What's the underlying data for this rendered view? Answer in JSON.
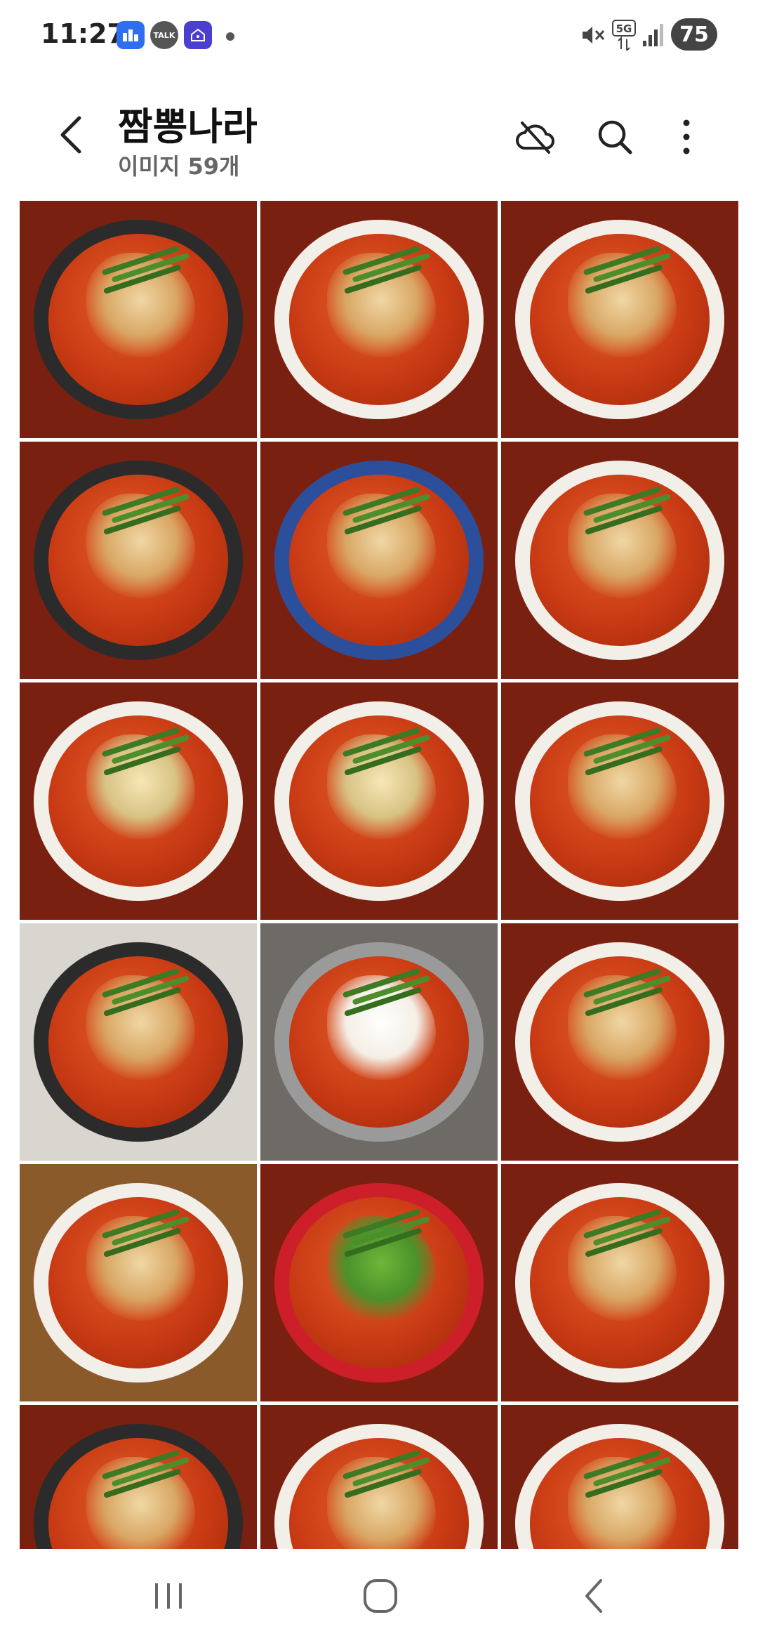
{
  "status_bar": {
    "time": "11:27",
    "notif_icons": [
      "home-app-icon",
      "talk-icon",
      "smart-home-icon"
    ],
    "talk_label": "TALK",
    "network_label": "5G",
    "battery": "75"
  },
  "header": {
    "title": "짬뽕나라",
    "subtitle": "이미지 59개"
  },
  "grid": {
    "columns": 3,
    "visible_rows": 6,
    "items": [
      {
        "style": "dark-bowl"
      },
      {
        "style": "white-bowl"
      },
      {
        "style": "white-bowl"
      },
      {
        "style": "dark-bowl"
      },
      {
        "style": "blue-bowl"
      },
      {
        "style": "white-bowl"
      },
      {
        "style": "white-bowl bean"
      },
      {
        "style": "white-bowl bean"
      },
      {
        "style": "white-bowl"
      },
      {
        "style": "dark-bowl bg-light"
      },
      {
        "style": "silver tofu bg-gray"
      },
      {
        "style": "white-bowl"
      },
      {
        "style": "white-bowl bg-wood"
      },
      {
        "style": "red-bowl pepper"
      },
      {
        "style": "white-bowl"
      },
      {
        "style": "dark-bowl"
      },
      {
        "style": "white-bowl"
      },
      {
        "style": "white-bowl"
      }
    ]
  },
  "colors": {
    "background": "#ffffff",
    "text_primary": "#111111",
    "text_secondary": "#666666",
    "icon": "#222222"
  }
}
